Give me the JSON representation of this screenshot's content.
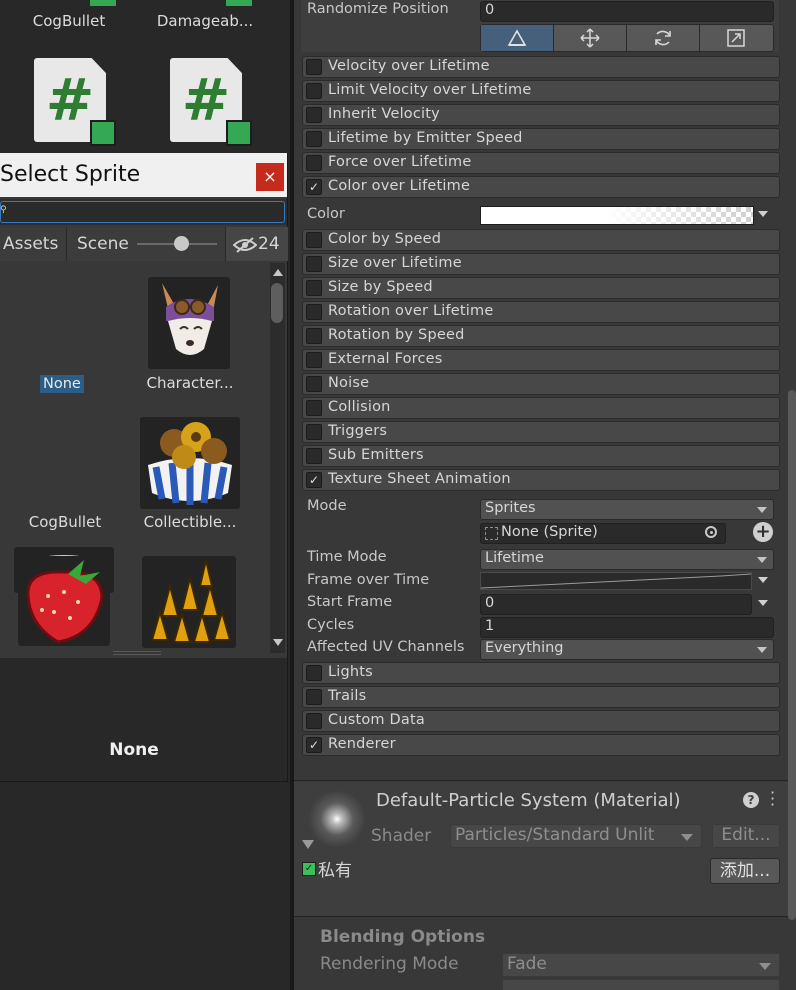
{
  "project": {
    "assets_top": [
      {
        "label": "CogBullet"
      },
      {
        "label": "Damageab..."
      }
    ],
    "scripts": [
      {
        "icon": "csharp-script-icon",
        "glyph": "#"
      },
      {
        "icon": "csharp-script-icon",
        "glyph": "#"
      }
    ]
  },
  "picker": {
    "title": "Select Sprite",
    "close": "×",
    "search_value": "",
    "tabs": {
      "assets": "Assets",
      "scene": "Scene",
      "hidden_count": "24"
    },
    "items": [
      {
        "label": "None",
        "selected": true
      },
      {
        "label": "Character..."
      },
      {
        "label": "CogBullet"
      },
      {
        "label": "Collectible..."
      },
      {
        "label": ""
      },
      {
        "label": ""
      }
    ],
    "preview_label": "None"
  },
  "inspector": {
    "randomize": {
      "label": "Randomize Position",
      "value": "0"
    },
    "modules_top": [
      {
        "label": "Velocity over Lifetime",
        "checked": false
      },
      {
        "label": "Limit Velocity over Lifetime",
        "checked": false
      },
      {
        "label": "Inherit Velocity",
        "checked": false
      },
      {
        "label": "Lifetime by Emitter Speed",
        "checked": false
      },
      {
        "label": "Force over Lifetime",
        "checked": false
      },
      {
        "label": "Color over Lifetime",
        "checked": true
      }
    ],
    "color_label": "Color",
    "modules_mid": [
      {
        "label": "Color by Speed",
        "checked": false
      },
      {
        "label": "Size over Lifetime",
        "checked": false
      },
      {
        "label": "Size by Speed",
        "checked": false
      },
      {
        "label": "Rotation over Lifetime",
        "checked": false
      },
      {
        "label": "Rotation by Speed",
        "checked": false
      },
      {
        "label": "External Forces",
        "checked": false
      },
      {
        "label": "Noise",
        "checked": false
      },
      {
        "label": "Collision",
        "checked": false
      },
      {
        "label": "Triggers",
        "checked": false
      },
      {
        "label": "Sub Emitters",
        "checked": false
      },
      {
        "label": "Texture Sheet Animation",
        "checked": true
      }
    ],
    "tsa": {
      "mode_label": "Mode",
      "mode_value": "Sprites",
      "sprite_value": "None (Sprite)",
      "time_mode_label": "Time Mode",
      "time_mode_value": "Lifetime",
      "frame_label": "Frame over Time",
      "start_frame_label": "Start Frame",
      "start_frame_value": "0",
      "cycles_label": "Cycles",
      "cycles_value": "1",
      "uv_label": "Affected UV Channels",
      "uv_value": "Everything"
    },
    "modules_bottom": [
      {
        "label": "Lights",
        "checked": false
      },
      {
        "label": "Trails",
        "checked": false
      },
      {
        "label": "Custom Data",
        "checked": false
      },
      {
        "label": "Renderer",
        "checked": true
      }
    ],
    "material": {
      "title": "Default-Particle System (Material)",
      "shader_label": "Shader",
      "shader_value": "Particles/Standard Unlit",
      "edit_button": "Edit...",
      "private_label": "私有",
      "add_button": "添加..."
    },
    "blending": {
      "title": "Blending Options",
      "rendering_mode_label": "Rendering Mode",
      "rendering_mode_value": "Fade"
    }
  }
}
